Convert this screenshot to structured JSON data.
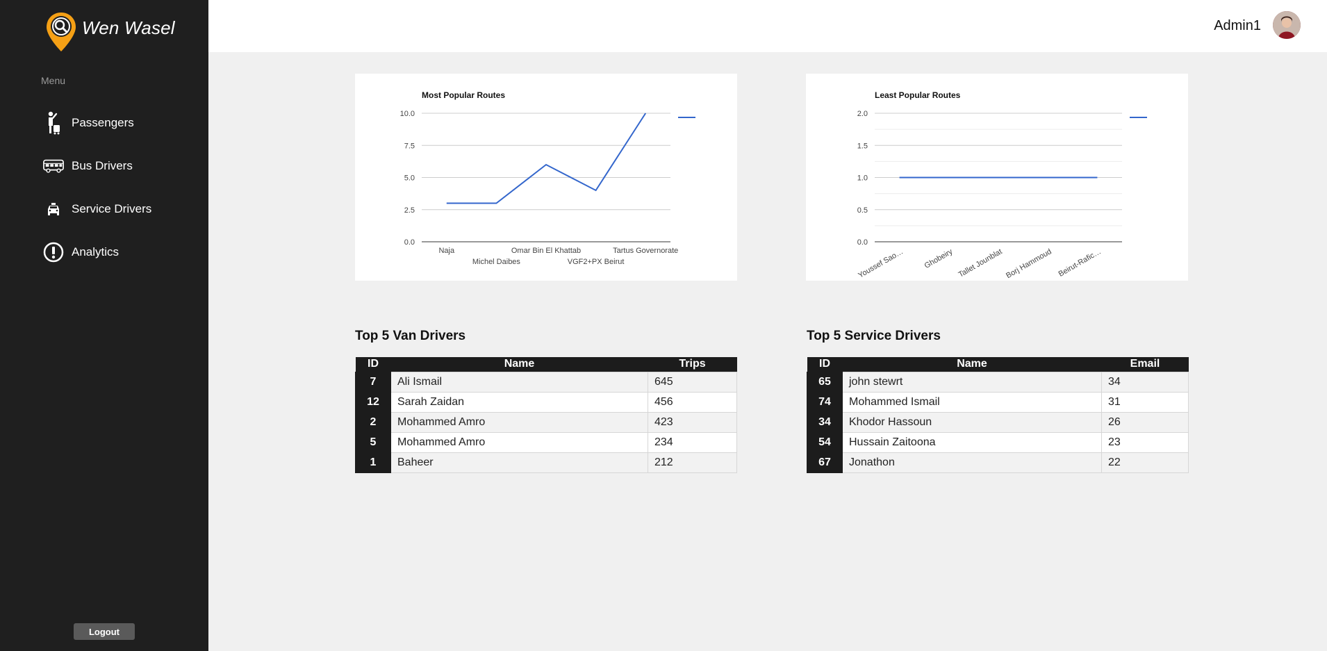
{
  "brand": {
    "name": "Wen Wasel"
  },
  "sidebar": {
    "menu_label": "Menu",
    "items": [
      {
        "label": "Passengers",
        "icon": "passenger-icon"
      },
      {
        "label": "Bus Drivers",
        "icon": "bus-icon"
      },
      {
        "label": "Service Drivers",
        "icon": "taxi-icon"
      },
      {
        "label": "Analytics",
        "icon": "alert-circle-icon"
      }
    ],
    "logout_label": "Logout"
  },
  "header": {
    "user_name": "Admin1"
  },
  "colors": {
    "sidebar": "#1f1f1f",
    "accent": "#f5a015",
    "line": "#3366cc"
  },
  "charts": [
    {
      "title": "Most Popular Routes",
      "type": "line",
      "categories": [
        "Naja",
        "Michel Daibes",
        "Omar Bin El Khattab",
        "VGF2+PX Beirut",
        "Tartus Governorate"
      ],
      "values": [
        3,
        3,
        6,
        4,
        10
      ],
      "y_ticks": [
        "0.0",
        "2.5",
        "5.0",
        "7.5",
        "10.0"
      ],
      "ylim": [
        0,
        10
      ]
    },
    {
      "title": "Least Popular Routes",
      "type": "line",
      "categories": [
        "Youssef Sao…",
        "Ghobeiry",
        "Tallet Jounblat",
        "Borj Hammoud",
        "Beirut-Rafic…"
      ],
      "values": [
        1,
        1,
        1,
        1,
        1
      ],
      "y_ticks": [
        "0.0",
        "0.5",
        "1.0",
        "1.5",
        "2.0"
      ],
      "ylim": [
        0,
        2
      ]
    }
  ],
  "chart_data": [
    {
      "type": "line",
      "title": "Most Popular Routes",
      "categories": [
        "Naja",
        "Michel Daibes",
        "Omar Bin El Khattab",
        "VGF2+PX Beirut",
        "Tartus Governorate"
      ],
      "values": [
        3,
        3,
        6,
        4,
        10
      ],
      "ylim": [
        0,
        10
      ],
      "grid": true,
      "legend": "right"
    },
    {
      "type": "line",
      "title": "Least Popular Routes",
      "categories": [
        "Youssef Sao…",
        "Ghobeiry",
        "Tallet Jounblat",
        "Borj Hammoud",
        "Beirut-Rafic…"
      ],
      "values": [
        1,
        1,
        1,
        1,
        1
      ],
      "ylim": [
        0,
        2
      ],
      "grid": true,
      "legend": "right"
    }
  ],
  "van_table": {
    "title": "Top 5 Van Drivers",
    "headers": [
      "ID",
      "Name",
      "Trips"
    ],
    "rows": [
      [
        "7",
        "Ali Ismail",
        "645"
      ],
      [
        "12",
        "Sarah Zaidan",
        "456"
      ],
      [
        "2",
        "Mohammed Amro",
        "423"
      ],
      [
        "5",
        "Mohammed Amro",
        "234"
      ],
      [
        "1",
        "Baheer",
        "212"
      ]
    ]
  },
  "service_table": {
    "title": "Top 5 Service Drivers",
    "headers": [
      "ID",
      "Name",
      "Email"
    ],
    "rows": [
      [
        "65",
        "john stewrt",
        "34"
      ],
      [
        "74",
        "Mohammed Ismail",
        "31"
      ],
      [
        "34",
        "Khodor Hassoun",
        "26"
      ],
      [
        "54",
        "Hussain Zaitoona",
        "23"
      ],
      [
        "67",
        "Jonathon",
        "22"
      ]
    ]
  }
}
